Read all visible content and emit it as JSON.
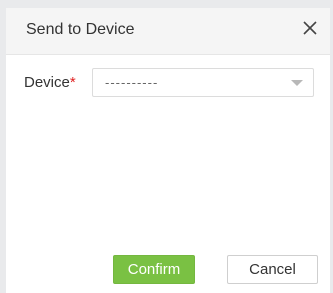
{
  "dialog": {
    "title": "Send to Device",
    "close_icon": "close-icon"
  },
  "form": {
    "device_label": "Device",
    "required_mark": "*",
    "device_value": "----------",
    "dropdown_icon": "chevron-down-icon"
  },
  "buttons": {
    "confirm_label": "Confirm",
    "cancel_label": "Cancel"
  },
  "colors": {
    "confirm_bg": "#7ac143",
    "required": "#e02020",
    "header_bg": "#f5f5f5",
    "backdrop": "#e9eaec"
  }
}
